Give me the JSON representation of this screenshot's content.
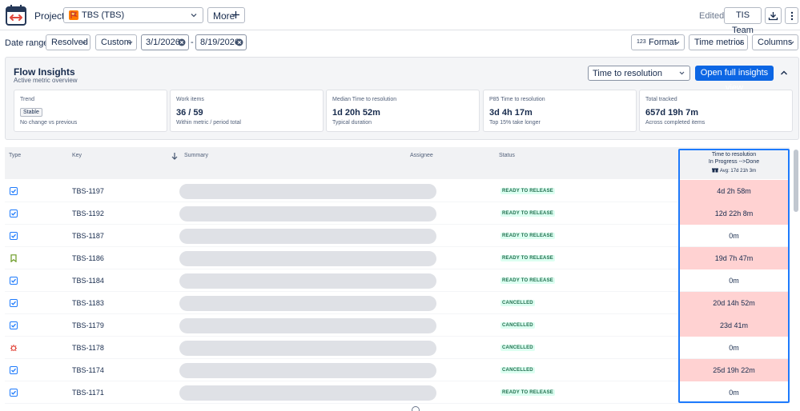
{
  "header": {
    "project_label": "Project:",
    "project_value": "TBS (TBS)",
    "more_label": "More",
    "edited_label": "Edited*",
    "team_label": "TIS Team"
  },
  "filters": {
    "date_ranges_label": "Date ranges:",
    "resolved_label": "Resolved",
    "custom_label": "Custom",
    "start_date": "3/1/2026",
    "separator": "-",
    "end_date": "8/19/2026",
    "format_label": "Format",
    "format_prefix": "123",
    "time_metrics_label": "Time metrics",
    "columns_label": "Columns"
  },
  "insights": {
    "title": "Flow Insights",
    "subtitle": "Active metric overview",
    "metric_select": "Time to resolution",
    "full_view_label": "Open full insights view",
    "cards": [
      {
        "label": "Trend",
        "badge": "Stable",
        "note": "No change vs previous"
      },
      {
        "label": "Work items",
        "value": "36 / 59",
        "note": "Within metric / period total"
      },
      {
        "label": "Median Time to resolution",
        "value": "1d 20h 52m",
        "note": "Typical duration"
      },
      {
        "label": "P85 Time to resolution",
        "value": "3d 4h 17m",
        "note": "Top 15% take longer"
      },
      {
        "label": "Total tracked",
        "value": "657d 19h 7m",
        "note": "Across completed items"
      }
    ]
  },
  "table": {
    "columns": {
      "type": "Type",
      "key": "Key",
      "summary": "Summary",
      "assignee": "Assignee",
      "status": "Status",
      "ttr_title": "Time to resolution",
      "ttr_sub": "In Progress -->Done",
      "ttr_avg": "Avg: 17d 21h 3m"
    },
    "rows": [
      {
        "type": "story",
        "key": "TBS-1197",
        "status": "READY TO RELEASE",
        "ttr": "4d 2h 58m",
        "highlight": true
      },
      {
        "type": "story",
        "key": "TBS-1192",
        "status": "READY TO RELEASE",
        "ttr": "12d 22h 8m",
        "highlight": true
      },
      {
        "type": "story",
        "key": "TBS-1187",
        "status": "READY TO RELEASE",
        "ttr": "0m",
        "highlight": false
      },
      {
        "type": "bookmark",
        "key": "TBS-1186",
        "status": "READY TO RELEASE",
        "ttr": "19d 7h 47m",
        "highlight": true
      },
      {
        "type": "story",
        "key": "TBS-1184",
        "status": "READY TO RELEASE",
        "ttr": "0m",
        "highlight": false
      },
      {
        "type": "story",
        "key": "TBS-1183",
        "status": "CANCELLED",
        "ttr": "20d 14h 52m",
        "highlight": true
      },
      {
        "type": "story",
        "key": "TBS-1179",
        "status": "CANCELLED",
        "ttr": "23d 41m",
        "highlight": true
      },
      {
        "type": "bug",
        "key": "TBS-1178",
        "status": "CANCELLED",
        "ttr": "0m",
        "highlight": false
      },
      {
        "type": "story",
        "key": "TBS-1174",
        "status": "CANCELLED",
        "ttr": "25d 19h 22m",
        "highlight": true
      },
      {
        "type": "story",
        "key": "TBS-1171",
        "status": "READY TO RELEASE",
        "ttr": "0m",
        "highlight": false
      }
    ]
  },
  "colors": {
    "primary": "#0c66e4",
    "highlight_cell": "#ffd2d2",
    "status_text": "#216e4e",
    "status_bg": "#dcfff1",
    "selected_column_border": "#1d7afc"
  },
  "icons": {
    "app_logo": "calendar-arrows-icon",
    "project": "project-flag-icon",
    "download": "download-icon",
    "kebab": "more-vertical-icon",
    "sort": "arrow-down-icon",
    "collapse": "chevron-up-icon",
    "avg": "gift-icon"
  }
}
